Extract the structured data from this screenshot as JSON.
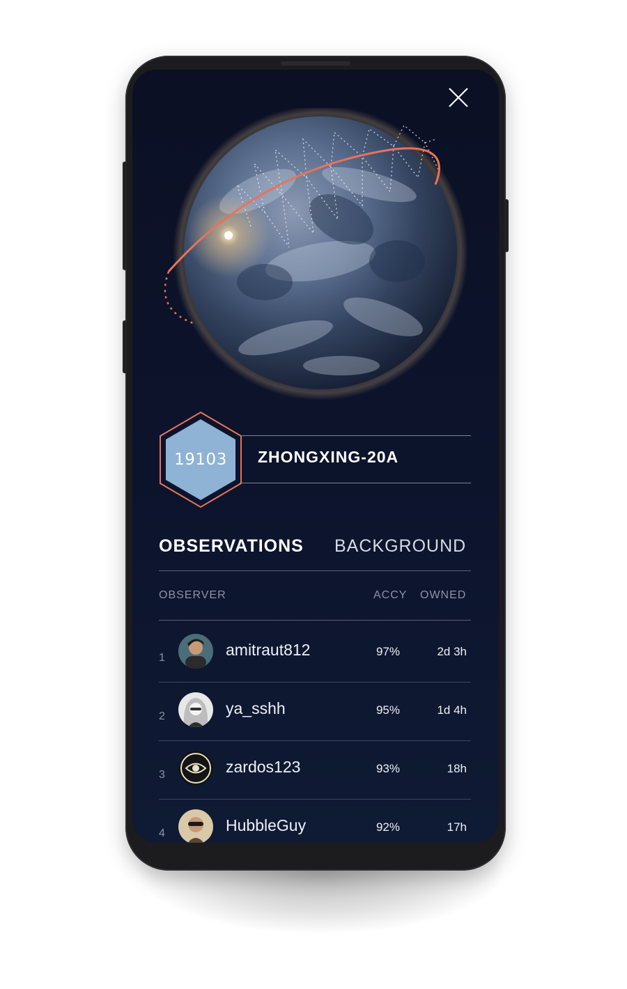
{
  "satellite": {
    "number": "19103",
    "name": "ZHONGXING-20A"
  },
  "tabs": [
    {
      "label": "OBSERVATIONS",
      "active": true
    },
    {
      "label": "BACKGROUND",
      "active": false
    }
  ],
  "table": {
    "columns": [
      "OBSERVER",
      "ACCY",
      "OWNED"
    ],
    "rows": [
      {
        "rank": "1",
        "observer": "amitraut812",
        "accy": "97%",
        "owned": "2d 3h",
        "avatar": "user-photo-avatar"
      },
      {
        "rank": "2",
        "observer": "ya_sshh",
        "accy": "95%",
        "owned": "1d 4h",
        "avatar": "user-photo-avatar"
      },
      {
        "rank": "3",
        "observer": "zardos123",
        "accy": "93%",
        "owned": "18h",
        "avatar": "eye-target-avatar"
      },
      {
        "rank": "4",
        "observer": "HubbleGuy",
        "accy": "92%",
        "owned": "17h",
        "avatar": "user-photo-avatar"
      }
    ]
  },
  "colors": {
    "background": "#0c132b",
    "accent": "#e8735a",
    "hex_fill": "#8fb3d4",
    "text": "#ffffff",
    "muted": "#8d93a6"
  },
  "icons": {
    "close": "close-icon"
  }
}
